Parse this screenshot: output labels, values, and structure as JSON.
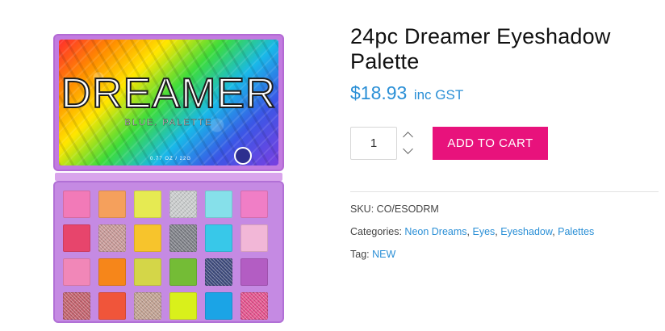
{
  "product": {
    "title": "24pc Dreamer Eyeshadow Palette",
    "price": "$18.93",
    "price_suffix": "inc GST",
    "quantity": "1",
    "add_to_cart_label": "ADD TO CART",
    "sku_label": "SKU:",
    "sku_value": "CO/ESODRM",
    "categories_label": "Categories:",
    "categories": [
      "Neon Dreams",
      "Eyes",
      "Eyeshadow",
      "Palettes"
    ],
    "tag_label": "Tag:",
    "tags": [
      "NEW"
    ]
  },
  "image": {
    "lid_title": "DREAMER",
    "lid_subtitle": "BLUE. PALETTE",
    "lid_weight": "0.77 OZ / 22G"
  },
  "colors": {
    "accent_pink": "#e8127c",
    "link_blue": "#2a8fd6",
    "pans": [
      [
        "#f27ab8",
        "#f5a05c",
        "#e6ea52",
        "#c9cccc",
        "#86e0ea",
        "#f07ec6"
      ],
      [
        "#e7456c",
        "#c79896",
        "#f7c42c",
        "#7d7f86",
        "#38c8e9",
        "#f2b7d7"
      ],
      [
        "#f187b8",
        "#f6861a",
        "#d4d648",
        "#74bc36",
        "#3d4a7c",
        "#b35dc3"
      ],
      [
        "#c2606b",
        "#f0553a",
        "#c0a090",
        "#d9f01b",
        "#1ba4e6",
        "#e3508b"
      ]
    ],
    "shimmer_pans": [
      "0-3",
      "1-1",
      "1-3",
      "2-4",
      "3-0",
      "3-2",
      "3-5"
    ]
  }
}
